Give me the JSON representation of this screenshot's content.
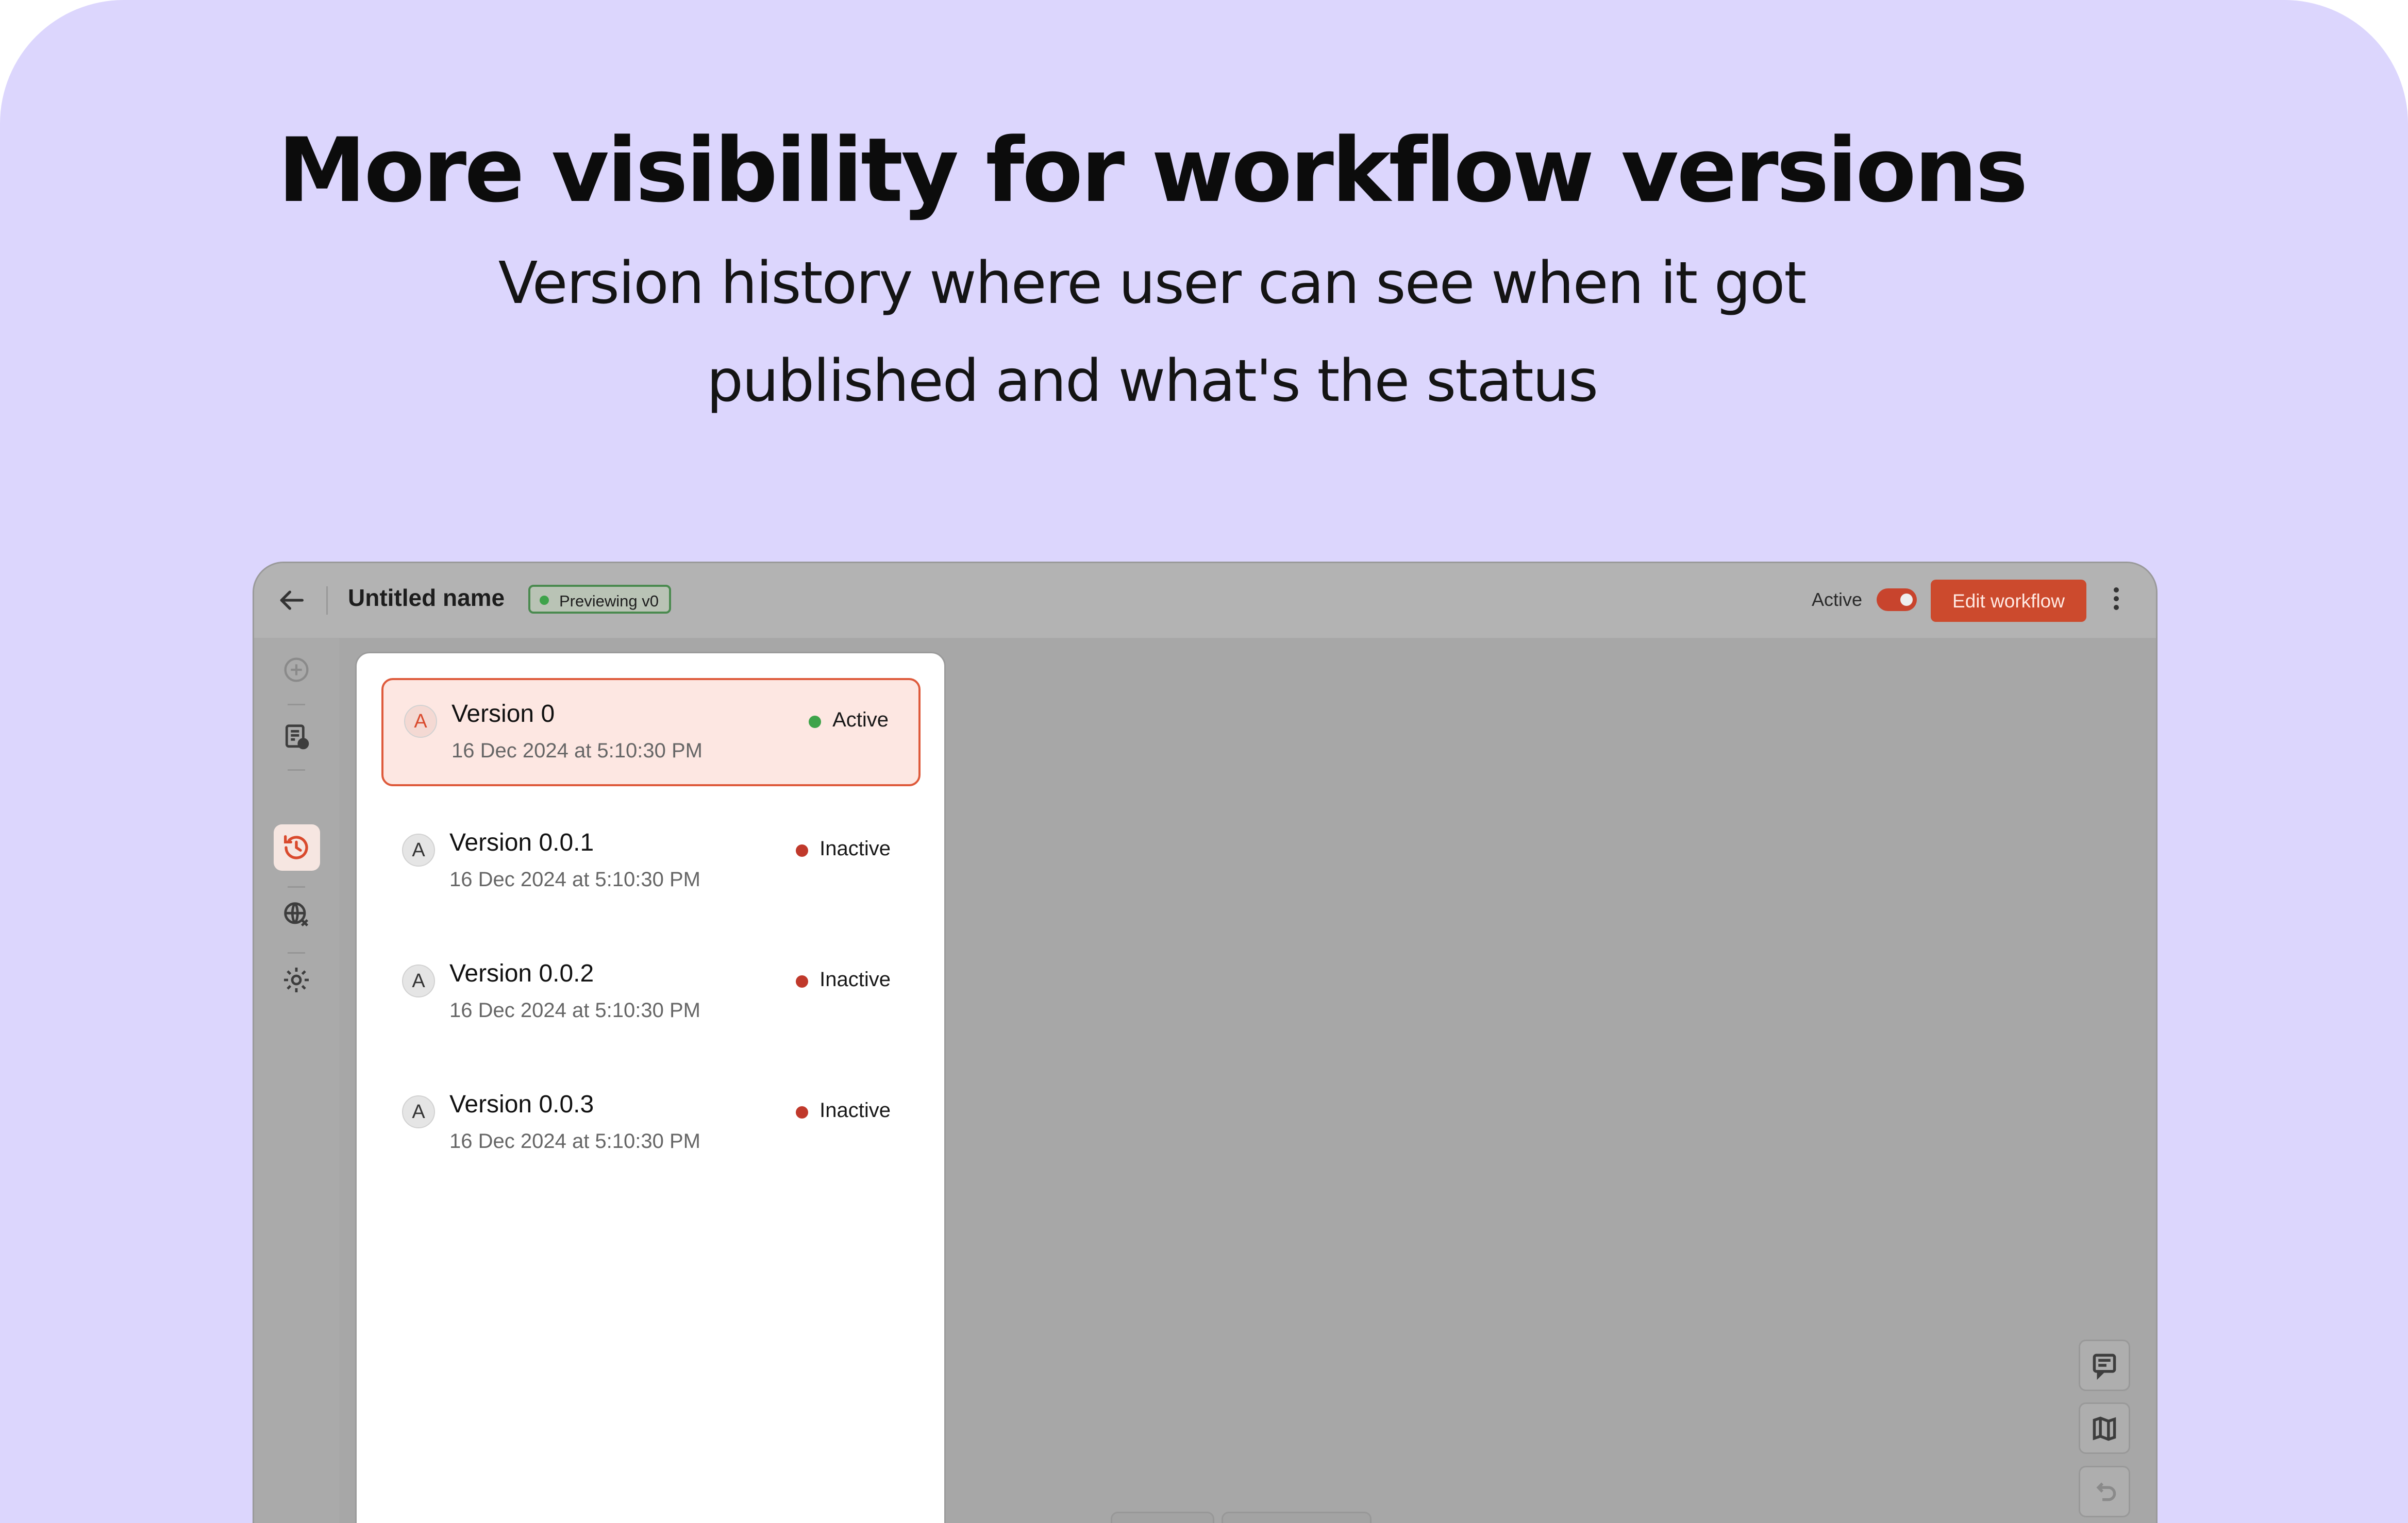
{
  "hero": {
    "headline": "More visibility for workflow versions",
    "subline_1": "Version history where user can see when it got",
    "subline_2": "published and what's the status"
  },
  "header": {
    "back_icon": "arrow-left-icon",
    "title": "Untitled name",
    "preview_badge": "Previewing v0",
    "active_label": "Active",
    "toggle_on": true,
    "edit_button": "Edit workflow",
    "more_icon": "kebab-menu-icon"
  },
  "rail": {
    "items": [
      "add-circle-icon",
      "document-clock-icon",
      "history-icon",
      "globe-x-icon",
      "gear-icon"
    ],
    "active": "history-icon"
  },
  "versions": [
    {
      "avatar": "A",
      "name": "Version 0",
      "date": "16 Dec 2024 at 5:10:30 PM",
      "status": "Active",
      "status_color": "#3ea34a",
      "selected": true
    },
    {
      "avatar": "A",
      "name": "Version 0.0.1",
      "date": "16 Dec 2024 at 5:10:30 PM",
      "status": "Inactive",
      "status_color": "#c0392b",
      "selected": false
    },
    {
      "avatar": "A",
      "name": "Version 0.0.2",
      "date": "16 Dec 2024 at 5:10:30 PM",
      "status": "Inactive",
      "status_color": "#c0392b",
      "selected": false
    },
    {
      "avatar": "A",
      "name": "Version 0.0.3",
      "date": "16 Dec 2024 at 5:10:30 PM",
      "status": "Inactive",
      "status_color": "#c0392b",
      "selected": false
    }
  ],
  "floating_tools": [
    "comment-icon",
    "map-icon",
    "undo-icon"
  ],
  "colors": {
    "background": "#dcd6fd",
    "accent": "#cc4a2d",
    "active_green": "#3ea34a",
    "inactive_red": "#c0392b"
  }
}
